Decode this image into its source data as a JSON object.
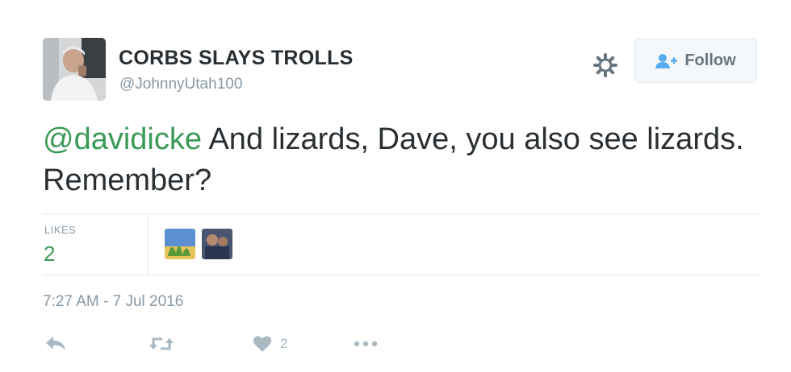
{
  "user": {
    "display_name": "CORBS SLAYS TROLLS",
    "screen_name": "@JohnnyUtah100",
    "avatar_icon": "profile-photo"
  },
  "header": {
    "gear_icon": "gear-icon",
    "follow_label": "Follow",
    "follow_icon": "add-user-icon"
  },
  "tweet": {
    "mention": "@davidicke",
    "text": " And lizards, Dave, you also see lizards. Remember?"
  },
  "stats": {
    "likes_label": "LIKES",
    "likes_count": "2",
    "likers": [
      "liker-avatar-1",
      "liker-avatar-2"
    ]
  },
  "timestamp": "7:27 AM - 7 Jul 2016",
  "actions": {
    "reply_icon": "reply-icon",
    "retweet_icon": "retweet-icon",
    "like_icon": "heart-icon",
    "like_count": "2",
    "more_icon": "more-icon"
  },
  "colors": {
    "accent": "#3b9a57",
    "text": "#292f33",
    "muted": "#8899a6"
  }
}
